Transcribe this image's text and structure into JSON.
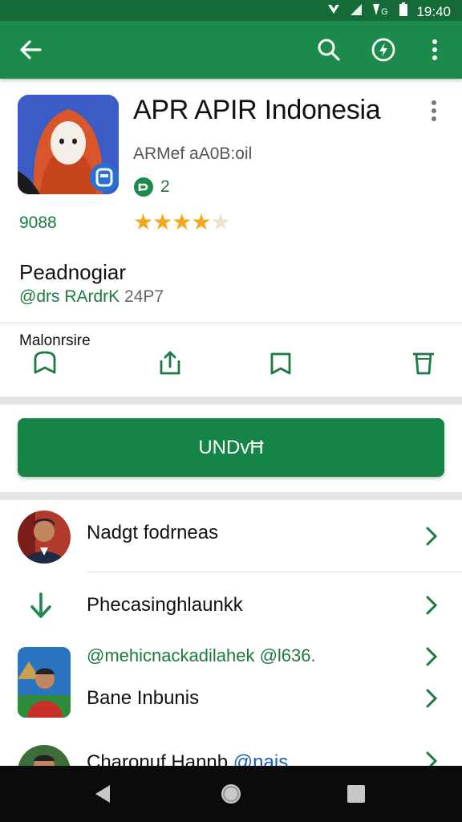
{
  "status_bar": {
    "time": "19:40"
  },
  "app": {
    "title": "APR APIR Indonesia",
    "developer": "ARMef aA0B:oil",
    "badge_count": "2",
    "rating_count": "9088",
    "rating_stars": 4.5,
    "category": "Peadnogiar",
    "sub_green": "@drs RArdrK",
    "sub_gray": "24P7"
  },
  "actions": {
    "label": "Malonrsire"
  },
  "install_button": {
    "label": "UNDvĦ"
  },
  "list": [
    {
      "label": "Nadgt fodrneas",
      "type": "avatar"
    },
    {
      "label": "Phecasinghlaunkk",
      "type": "download"
    },
    {
      "label": "@mehicnackadilahek",
      "label2": "@l636.",
      "type": "link"
    },
    {
      "label": "Bane Inbunis",
      "type": "avatar2"
    },
    {
      "label": "Charonuf Hannb",
      "label2": "@nais",
      "type": "avatar3"
    }
  ],
  "colors": {
    "primary": "#1b8a4a",
    "status": "#146b38",
    "accent_green": "#1b7a42",
    "star": "#f2a81b"
  }
}
